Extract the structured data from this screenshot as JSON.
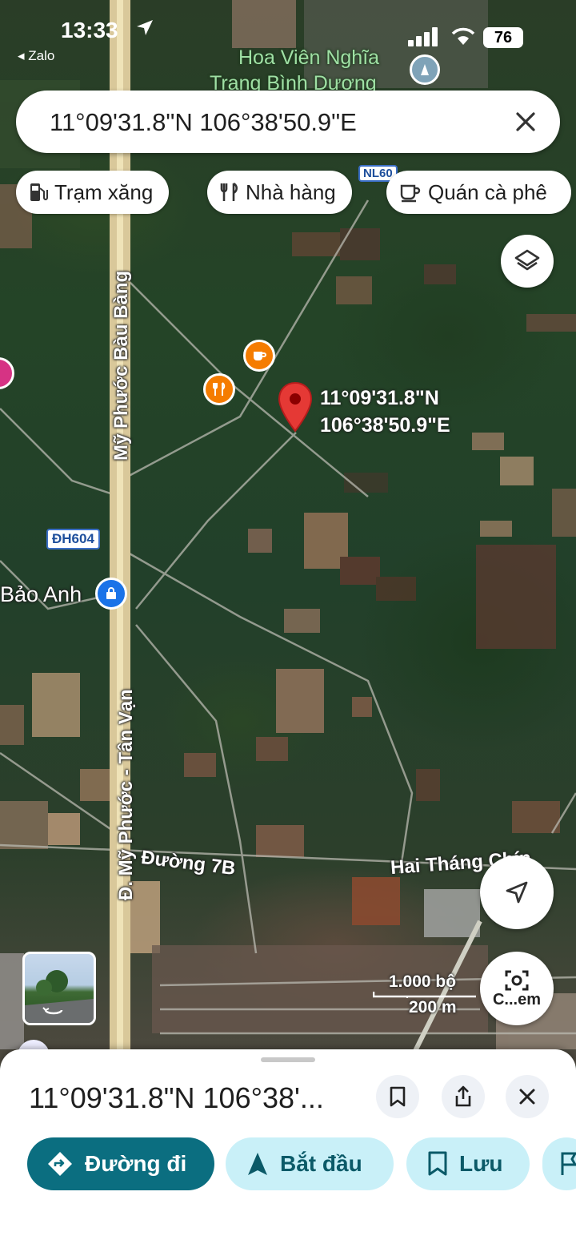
{
  "status_bar": {
    "time": "13:33",
    "back_app": "◂ Zalo",
    "battery": "76"
  },
  "search": {
    "query": "11°09'31.8\"N 106°38'50.9\"E"
  },
  "chips": [
    {
      "label": "Trạm xăng",
      "icon": "gas-station-icon"
    },
    {
      "label": "Nhà hàng",
      "icon": "restaurant-icon"
    },
    {
      "label": "Quán cà phê",
      "icon": "coffee-icon"
    }
  ],
  "map": {
    "labels": {
      "cemetery_line1": "Hoa Viên Nghĩa",
      "cemetery_line2": "Trang Bình Dương",
      "road_vertical_top": "Mỹ Phước Bàu Bàng",
      "road_vertical_bottom": "Đ. Mỹ Phước - Tân Vạn",
      "route_shield": "ĐH604",
      "route_shield_top": "NL60",
      "place_bao_anh": "Bảo Anh",
      "street_7b": "Đường 7B",
      "street_hai_thang_chin": "Hai Tháng Chín"
    },
    "pin": {
      "lat": "11°09'31.8\"N",
      "lng": "106°38'50.9\"E"
    },
    "scale": {
      "feet": "1.000 bộ",
      "meters": "200 m"
    },
    "camera_button_label": "C...em"
  },
  "colors": {
    "pin_red": "#e53935",
    "poi_orange": "#f57c00",
    "poi_blue": "#1a73e8",
    "action_primary": "#0b6e80",
    "action_secondary": "#c9f0f8"
  },
  "sheet": {
    "title": "11°09'31.8\"N 106°38'...",
    "actions": [
      {
        "label": "Đường đi",
        "icon": "directions-icon"
      },
      {
        "label": "Bắt đầu",
        "icon": "navigation-arrow-icon"
      },
      {
        "label": "Lưu",
        "icon": "bookmark-icon"
      }
    ]
  }
}
